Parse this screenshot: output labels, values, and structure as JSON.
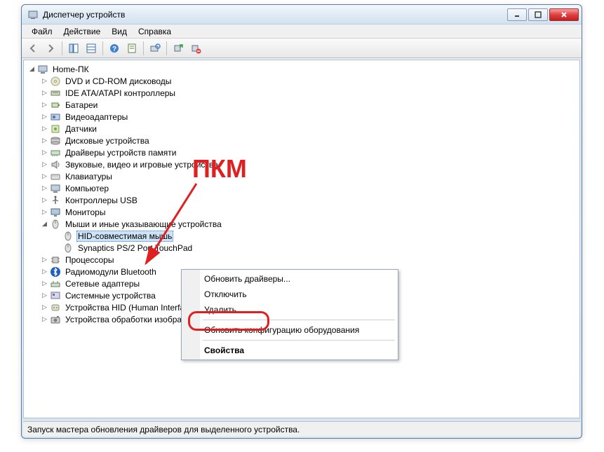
{
  "window": {
    "title": "Диспетчер устройств"
  },
  "menubar": {
    "file": "Файл",
    "action": "Действие",
    "view": "Вид",
    "help": "Справка"
  },
  "tree": {
    "root": "Home-ПК",
    "items": [
      {
        "icon": "dvd",
        "label": "DVD и CD-ROM дисководы"
      },
      {
        "icon": "ide",
        "label": "IDE ATA/ATAPI контроллеры"
      },
      {
        "icon": "battery",
        "label": "Батареи"
      },
      {
        "icon": "video",
        "label": "Видеоадаптеры"
      },
      {
        "icon": "sensor",
        "label": "Датчики"
      },
      {
        "icon": "disk",
        "label": "Дисковые устройства"
      },
      {
        "icon": "memory",
        "label": "Драйверы устройств памяти"
      },
      {
        "icon": "sound",
        "label": "Звуковые, видео и игровые устройства"
      },
      {
        "icon": "keyboard",
        "label": "Клавиатуры"
      },
      {
        "icon": "computer",
        "label": "Компьютер"
      },
      {
        "icon": "usb",
        "label": "Контроллеры USB"
      },
      {
        "icon": "monitor",
        "label": "Мониторы"
      },
      {
        "icon": "mouse",
        "label": "Мыши и иные указывающие устройства",
        "expanded": true,
        "children": [
          {
            "icon": "mouse",
            "label": "HID-совместимая мышь",
            "selected": true
          },
          {
            "icon": "mouse",
            "label": "Synaptics PS/2 Port TouchPad"
          }
        ]
      },
      {
        "icon": "cpu",
        "label": "Процессоры"
      },
      {
        "icon": "bluetooth",
        "label": "Радиомодули Bluetooth"
      },
      {
        "icon": "network",
        "label": "Сетевые адаптеры"
      },
      {
        "icon": "system",
        "label": "Системные устройства"
      },
      {
        "icon": "hid",
        "label": "Устройства HID (Human Interface Devices)"
      },
      {
        "icon": "imaging",
        "label": "Устройства обработки изображений"
      }
    ]
  },
  "context_menu": {
    "update_drivers": "Обновить драйверы...",
    "disable": "Отключить",
    "delete": "Удалить",
    "update_config": "Обновить конфигурацию оборудования",
    "properties": "Свойства"
  },
  "statusbar": {
    "text": "Запуск мастера обновления драйверов для выделенного устройства."
  },
  "annotation": {
    "label": "ПКМ"
  }
}
